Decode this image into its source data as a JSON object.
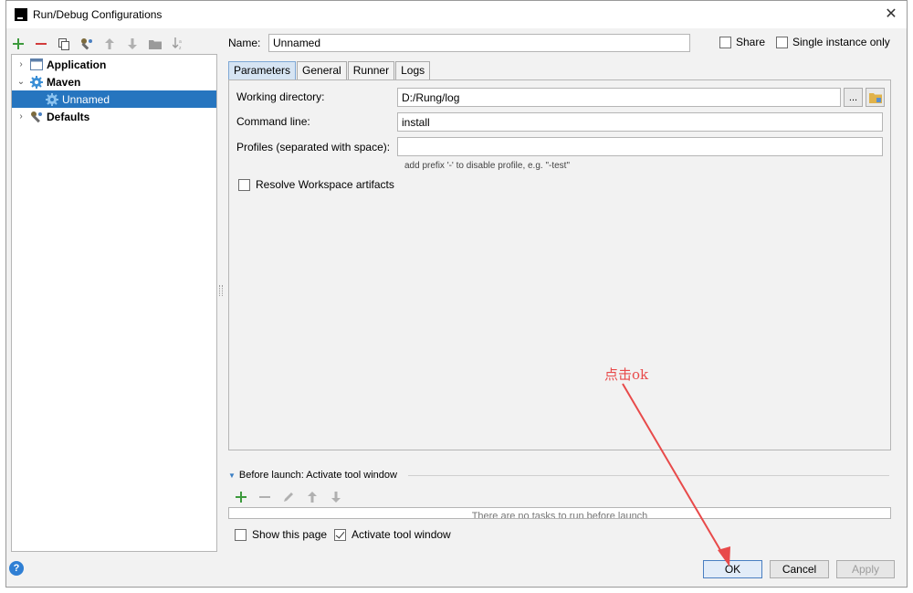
{
  "window": {
    "title": "Run/Debug Configurations"
  },
  "tree": {
    "items": [
      {
        "label": "Application",
        "expanded": false
      },
      {
        "label": "Maven",
        "expanded": true
      },
      {
        "label": "Unnamed",
        "selected": true
      },
      {
        "label": "Defaults",
        "expanded": false
      }
    ]
  },
  "form": {
    "name_label": "Name:",
    "name_value": "Unnamed",
    "share_label": "Share",
    "single_instance_label": "Single instance only",
    "tabs": [
      "Parameters",
      "General",
      "Runner",
      "Logs"
    ],
    "working_directory_label": "Working directory:",
    "working_directory_value": "D:/Rung/log",
    "browse_label": "...",
    "command_line_label": "Command line:",
    "command_line_value": "install",
    "profiles_label": "Profiles (separated with space):",
    "profiles_value": "",
    "profiles_hint": "add prefix '-' to disable profile, e.g. \"-test\"",
    "resolve_workspace_label": "Resolve Workspace artifacts"
  },
  "before_launch": {
    "header": "Before launch: Activate tool window",
    "empty_text": "There are no tasks to run before launch",
    "show_page_label": "Show this page",
    "show_page_checked": false,
    "activate_tool_window_label": "Activate tool window",
    "activate_tool_window_checked": true
  },
  "buttons": {
    "ok": "OK",
    "cancel": "Cancel",
    "apply": "Apply",
    "help": "?"
  },
  "annotation": {
    "text": "点击ok",
    "color": "#e84a4a"
  },
  "colors": {
    "selection": "#2675bf",
    "accent_green": "#3d9a3d",
    "accent_red": "#d23c3c"
  }
}
